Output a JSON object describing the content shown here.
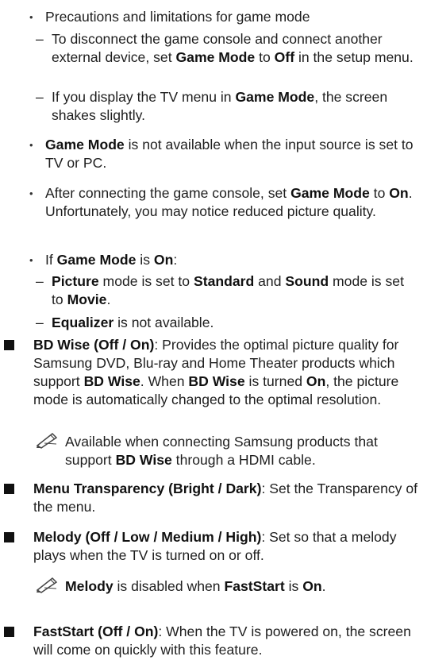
{
  "section1": {
    "title": "Precautions and limitations for game mode",
    "dash1": [
      {
        "t": "To disconnect the game console and connect another external device, set "
      },
      {
        "b": "Game Mode"
      },
      {
        "t": " to "
      },
      {
        "b": "Off"
      },
      {
        "t": " in the setup menu."
      }
    ],
    "dash2": [
      {
        "t": "If you display the TV menu in "
      },
      {
        "b": "Game Mode"
      },
      {
        "t": ", the screen shakes slightly."
      }
    ]
  },
  "bullet2": [
    {
      "b": "Game Mode"
    },
    {
      "t": " is not available when the input source is set to TV or PC."
    }
  ],
  "bullet3": [
    {
      "t": "After connecting the game console, set "
    },
    {
      "b": "Game Mode"
    },
    {
      "t": " to "
    },
    {
      "b": "On"
    },
    {
      "t": ". Unfortunately, you may notice reduced picture quality."
    }
  ],
  "bullet4": {
    "intro": [
      {
        "t": "If "
      },
      {
        "b": "Game Mode"
      },
      {
        "t": " is "
      },
      {
        "b": "On"
      },
      {
        "t": ":"
      }
    ],
    "dash1": [
      {
        "b": "Picture"
      },
      {
        "t": " mode is set to "
      },
      {
        "b": "Standard"
      },
      {
        "t": " and "
      },
      {
        "b": "Sound"
      },
      {
        "t": " mode is set to "
      },
      {
        "b": "Movie"
      },
      {
        "t": "."
      }
    ],
    "dash2": [
      {
        "b": "Equalizer"
      },
      {
        "t": " is not available."
      }
    ]
  },
  "bd_wise": {
    "text": [
      {
        "b": "BD Wise (Off / On)"
      },
      {
        "t": ": Provides the optimal picture quality for Samsung DVD, Blu-ray and Home Theater products which support "
      },
      {
        "b": "BD Wise"
      },
      {
        "t": ". When "
      },
      {
        "b": "BD Wise"
      },
      {
        "t": " is turned "
      },
      {
        "b": "On"
      },
      {
        "t": ", the picture mode is automatically changed to the optimal resolution."
      }
    ],
    "note": [
      {
        "t": "Available when connecting Samsung products that support "
      },
      {
        "b": "BD Wise"
      },
      {
        "t": " through a HDMI cable."
      }
    ]
  },
  "menu_transparency": {
    "text": [
      {
        "b": "Menu Transparency (Bright / Dark)"
      },
      {
        "t": ": Set the Transparency of the menu."
      }
    ]
  },
  "melody": {
    "text": [
      {
        "b": "Melody (Off / Low / Medium / High)"
      },
      {
        "t": ": Set so that a melody plays when the TV is turned on or off."
      }
    ],
    "note": [
      {
        "b": "Melody"
      },
      {
        "t": " is disabled when "
      },
      {
        "b": "FastStart"
      },
      {
        "t": " is "
      },
      {
        "b": "On"
      },
      {
        "t": "."
      }
    ]
  },
  "faststart": {
    "text": [
      {
        "b": "FastStart (Off / On)"
      },
      {
        "t": ": When the TV is powered on, the screen will come on quickly with this feature."
      }
    ]
  },
  "glyphs": {
    "bullet": "•",
    "dash": "–",
    "note_icon": "pencil-note-icon"
  }
}
